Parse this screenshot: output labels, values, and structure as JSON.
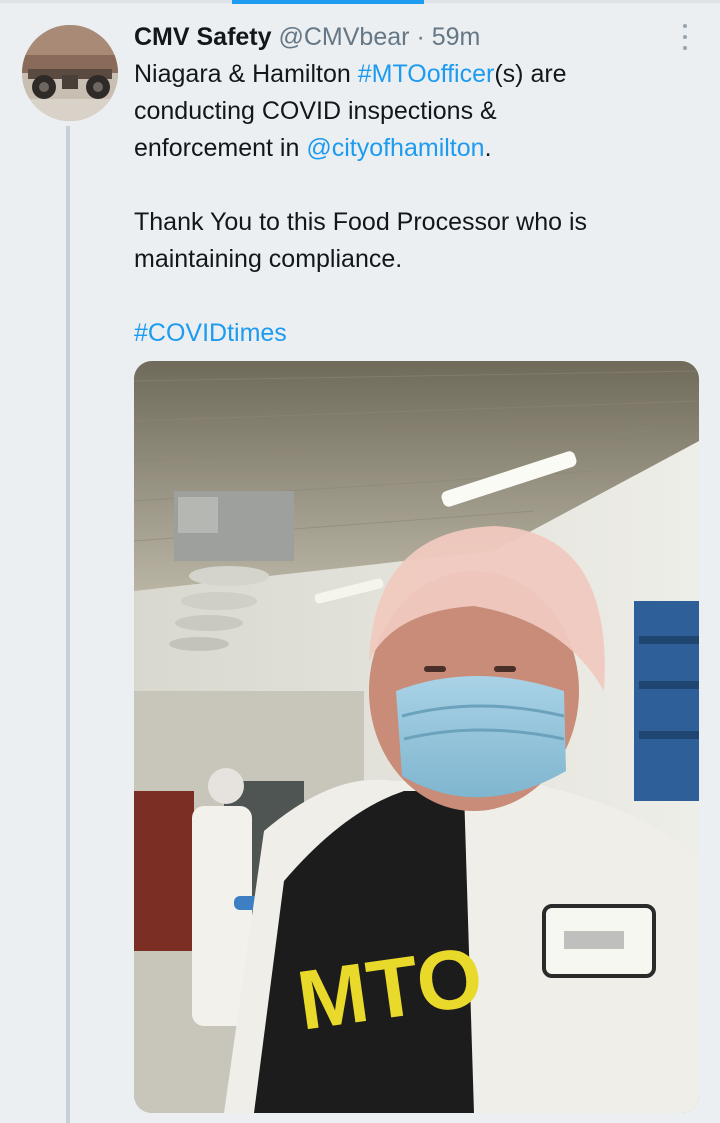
{
  "tweet": {
    "author_name": "CMV Safety",
    "handle": "@CMVbear",
    "separator": "·",
    "time": "59m",
    "text_line1_a": "Niagara & Hamilton ",
    "hashtag_mto": "#MTOofficer",
    "text_line1_b": "(s) are",
    "text_line2": "conducting COVID inspections &",
    "text_line3_a": "enforcement in ",
    "mention_city": "@cityofhamilton",
    "text_line3_b": ".",
    "text_para2": "Thank You to this Food Processor who is maintaining compliance.",
    "hashtag_covid": "#COVIDtimes"
  },
  "media": {
    "vest_text": "MTO"
  },
  "colors": {
    "link": "#1d9bf0",
    "name": "#14171a",
    "meta": "#657786",
    "background": "#eceff1"
  },
  "icons": {
    "more": "more-vertical-icon"
  }
}
